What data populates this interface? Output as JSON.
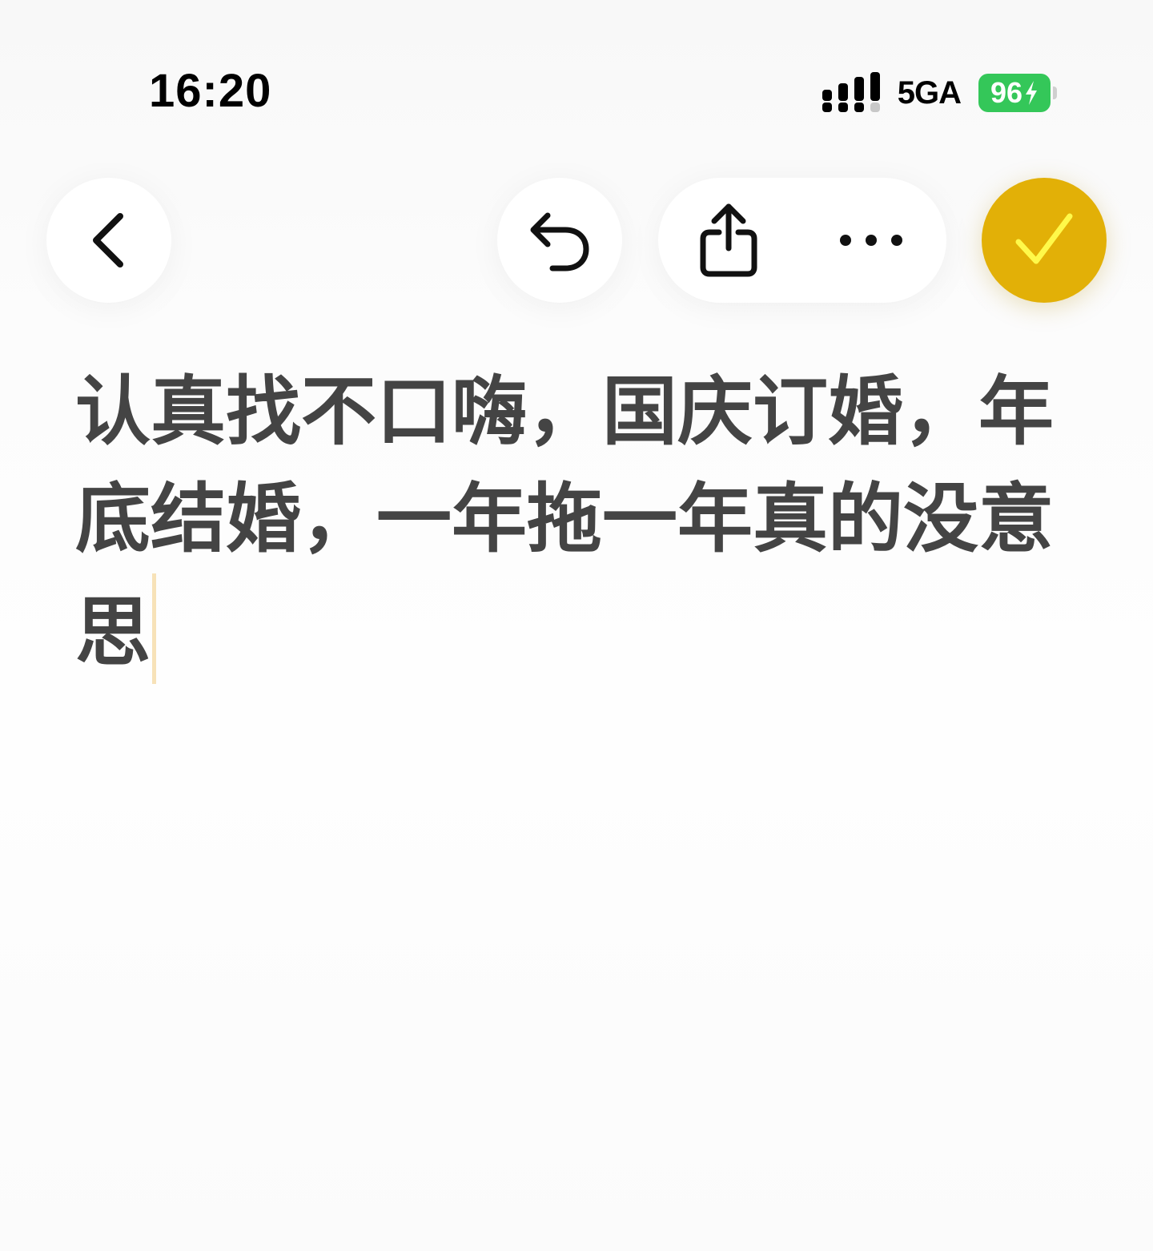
{
  "status_bar": {
    "time": "16:20",
    "network": "5GA",
    "battery_level": "96",
    "battery_color": "#34c759"
  },
  "toolbar": {
    "back_icon": "chevron-left-icon",
    "undo_icon": "undo-icon",
    "share_icon": "share-icon",
    "more_icon": "ellipsis-icon",
    "done_icon": "checkmark-icon",
    "done_color": "#e2b007"
  },
  "note": {
    "body": "认真找不口嗨，国庆订婚，年底结婚，一年拖一年真的没意思"
  }
}
